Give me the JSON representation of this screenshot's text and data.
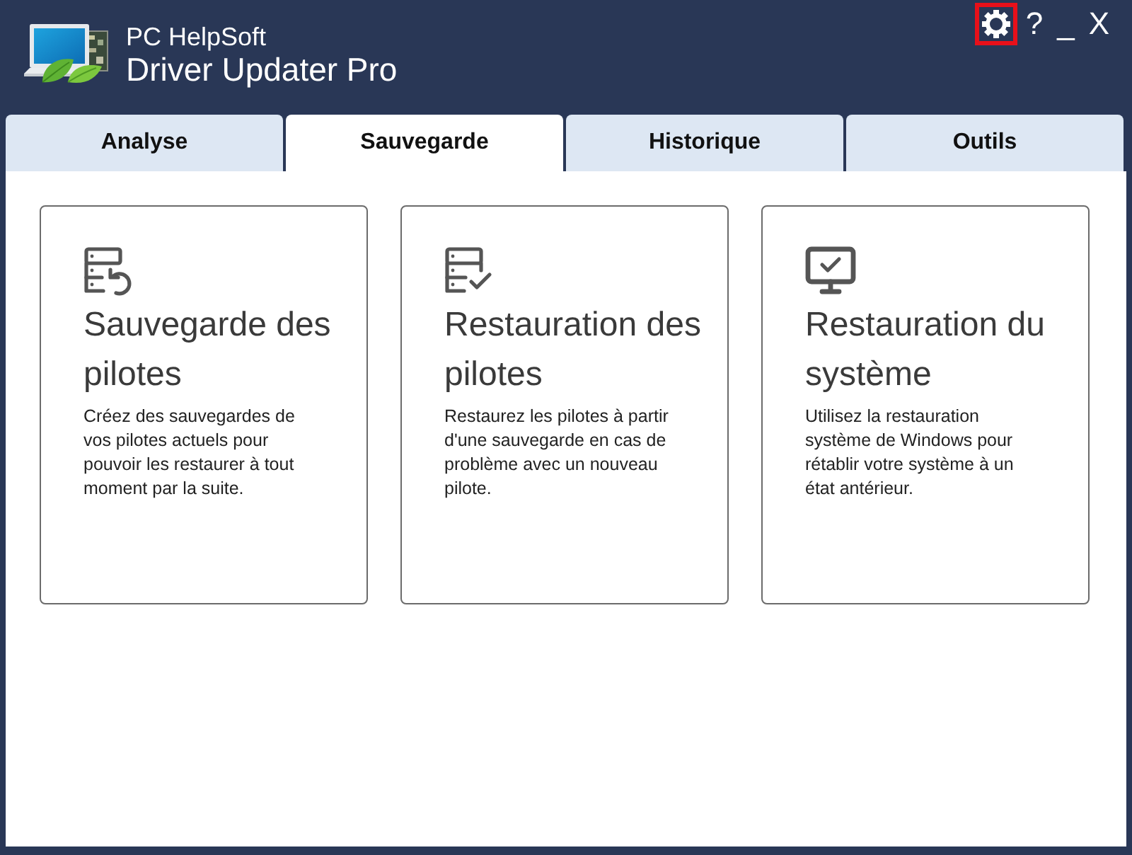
{
  "header": {
    "vendor": "PC HelpSoft",
    "product": "Driver Updater Pro"
  },
  "title_buttons": [
    {
      "kind": "settings",
      "highlighted": true
    },
    {
      "kind": "help",
      "label": "?",
      "highlighted": false
    },
    {
      "kind": "minimize",
      "label": "_",
      "highlighted": false
    },
    {
      "kind": "close",
      "label": "X",
      "highlighted": false
    }
  ],
  "tabs": [
    {
      "label": "Analyse",
      "selected": false
    },
    {
      "label": "Sauvegarde",
      "selected": true
    },
    {
      "label": "Historique",
      "selected": false
    },
    {
      "label": "Outils",
      "selected": false
    }
  ],
  "cards": [
    {
      "kind": "backup",
      "title": "Sauvegarde des pilotes",
      "description": "Créez des sauvegardes de vos pilotes actuels pour pouvoir les restaurer à tout moment par la suite."
    },
    {
      "kind": "restore",
      "title": "Restauration des pilotes",
      "description": "Restaurez les pilotes à partir d'une sauvegarde en cas de problème avec un nouveau pilote."
    },
    {
      "kind": "system",
      "title": "Restauration du système",
      "description": "Utilisez la restauration système de Windows pour rétablir votre système à un état antérieur."
    }
  ]
}
